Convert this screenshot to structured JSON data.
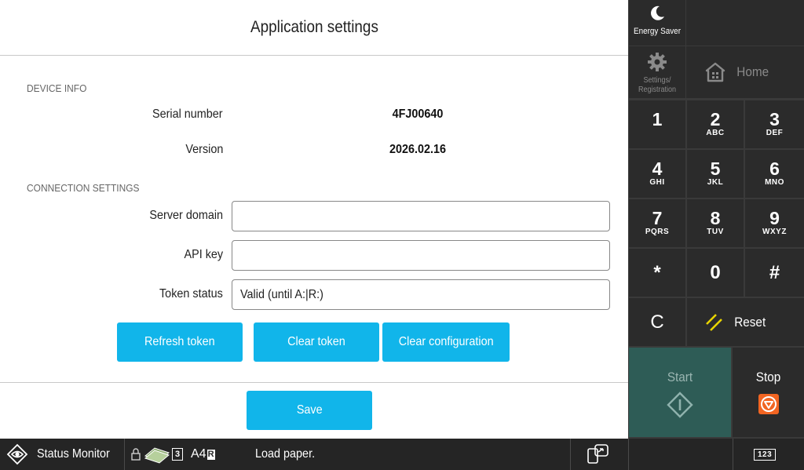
{
  "app": {
    "title": "Application settings",
    "device_info": {
      "section_label": "DEVICE INFO",
      "serial_label": "Serial number",
      "serial_value": "4FJ00640",
      "version_label": "Version",
      "version_value": "2026.02.16"
    },
    "connection": {
      "section_label": "CONNECTION SETTINGS",
      "server_label": "Server domain",
      "server_value": "",
      "api_label": "API key",
      "api_value": "",
      "token_label": "Token status",
      "token_value": "Valid (until A:|R:)"
    },
    "buttons": {
      "refresh": "Refresh token",
      "clear_token": "Clear token",
      "clear_config": "Clear configuration",
      "save": "Save"
    },
    "accent_color": "#11b5ea"
  },
  "panel": {
    "energy_saver": "Energy Saver",
    "settings_line1": "Settings/",
    "settings_line2": "Registration",
    "home": "Home",
    "keys": [
      {
        "digit": "1",
        "letters": ""
      },
      {
        "digit": "2",
        "letters": "ABC"
      },
      {
        "digit": "3",
        "letters": "DEF"
      },
      {
        "digit": "4",
        "letters": "GHI"
      },
      {
        "digit": "5",
        "letters": "JKL"
      },
      {
        "digit": "6",
        "letters": "MNO"
      },
      {
        "digit": "7",
        "letters": "PQRS"
      },
      {
        "digit": "8",
        "letters": "TUV"
      },
      {
        "digit": "9",
        "letters": "WXYZ"
      },
      {
        "digit": "*",
        "letters": ""
      },
      {
        "digit": "0",
        "letters": ""
      },
      {
        "digit": "#",
        "letters": ""
      }
    ],
    "clear_key": "C",
    "reset": "Reset",
    "start": "Start",
    "stop": "Stop",
    "start_color": "#2e5c56",
    "stop_icon_color": "#f26522"
  },
  "statusbar": {
    "status_monitor": "Status Monitor",
    "tray_count": "3",
    "paper_size": "A4",
    "paper_badge": "R",
    "message": "Load paper.",
    "keypad_label": "123"
  }
}
